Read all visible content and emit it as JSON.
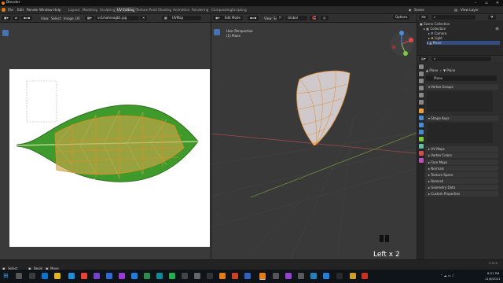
{
  "window": {
    "title": "Blender"
  },
  "menubar": {
    "items": [
      "File",
      "Edit",
      "Render",
      "Window",
      "Help"
    ],
    "workspace_tabs": [
      {
        "label": "Layout",
        "active": false
      },
      {
        "label": "Modeling",
        "active": false
      },
      {
        "label": "Sculpting",
        "active": false
      },
      {
        "label": "UV Editing",
        "active": true
      },
      {
        "label": "Texture Paint",
        "active": false
      },
      {
        "label": "Shading",
        "active": false
      },
      {
        "label": "Animation",
        "active": false
      },
      {
        "label": "Rendering",
        "active": false
      },
      {
        "label": "Compositing",
        "active": false
      },
      {
        "label": "Scripting",
        "active": false
      }
    ],
    "scene_label": "Scene",
    "view_layer_label": "View Layer"
  },
  "uv_editor": {
    "menu": [
      "View",
      "Select",
      "Image",
      "UV"
    ],
    "image_name": "vs1mahreagb1.jpg",
    "uvmap_name": "UVMap"
  },
  "viewport": {
    "mode": "Edit Mode",
    "menu": [
      "View",
      "Select",
      "Add",
      "Mesh",
      "Vertex",
      "Edge",
      "Face",
      "UV"
    ],
    "transform_orientation": "Global",
    "options_label": "Options",
    "overlay_line1": "User Perspective",
    "overlay_line2": "(1) Plane",
    "key_overlay": "Left x 2"
  },
  "outliner": {
    "root": "Scene Collection",
    "items": [
      "Collection",
      "Camera",
      "Light",
      "Plane"
    ]
  },
  "properties": {
    "object_name": "Plane",
    "mesh_name": "Plane",
    "panels": [
      "Vertex Groups",
      "Shape Keys",
      "UV Maps",
      "Vertex Colors",
      "Face Maps",
      "Normals",
      "Texture Space",
      "Remesh",
      "Geometry Data",
      "Custom Properties"
    ]
  },
  "statusbar": {
    "left_items": [
      "Select",
      "Begin",
      "Move"
    ],
    "version": "2.92.0"
  },
  "taskbar": {
    "time": "8:21 PM",
    "date": "11/6/2021"
  },
  "colors": {
    "accent_blue": "#4772b3",
    "blender_orange": "#e87d0d",
    "leaf_green": "#3f9a2c",
    "uv_overlay": "#c8a84a"
  }
}
